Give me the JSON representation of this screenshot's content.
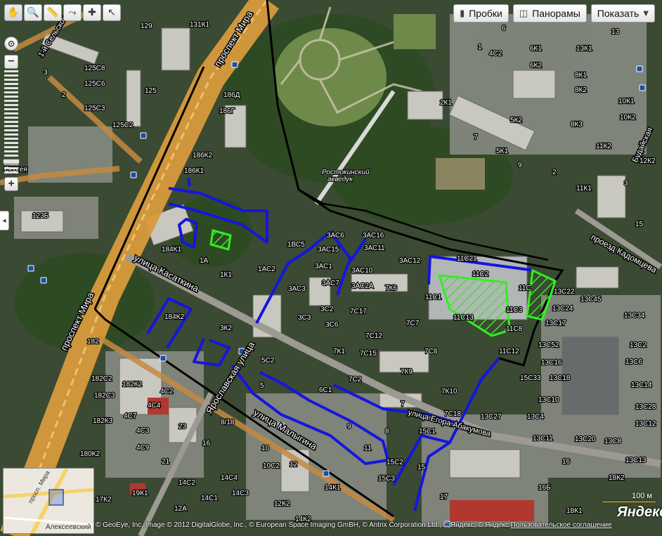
{
  "toolbar": {
    "tools": [
      {
        "name": "pan-tool",
        "glyph": "✋"
      },
      {
        "name": "magnifier-tool",
        "glyph": "🔍"
      },
      {
        "name": "ruler-tool",
        "glyph": "📏"
      },
      {
        "name": "route-tool",
        "glyph": "⤳"
      },
      {
        "name": "add-object-tool",
        "glyph": "✚"
      },
      {
        "name": "select-tool",
        "glyph": "↖"
      }
    ]
  },
  "buttons": {
    "traffic_label": "Пробки",
    "panoramas_label": "Панорамы",
    "show_label": "Показать",
    "show_arrow": "▼"
  },
  "zoom": {
    "plus": "+",
    "minus": "−",
    "reset": "⊙"
  },
  "side_tab": "◂",
  "street_labels": {
    "prospekt_mira_top": "проспект Мира",
    "prospekt_mira_bottom": "проспект Мира",
    "ul_kasatkina": "улица Касаткина",
    "yaroslavskaya": "Ярославская улица",
    "ul_malygina": "улица Малыгина",
    "ul_egora": "улица Егора Абакумова",
    "rostokinsky": "Ростокинский акведук",
    "proezd_kadomtseva": "проезд Кадомцева",
    "budaysk": "Будайская",
    "sergeya": "Сергея",
    "first_selskokh": "1-й Сельскох"
  },
  "house_numbers": [
    "129",
    "131К1",
    "125С8",
    "125С6",
    "125С3",
    "125С2",
    "125",
    "2",
    "3",
    "186Д",
    "186Г",
    "186К2",
    "186К1",
    "123Б",
    "184К1",
    "1А",
    "1К1",
    "1АС2",
    "1ВС5",
    "3АС6",
    "3АС16",
    "3АС15",
    "3АС1",
    "3АС11",
    "3АС10",
    "3АС3",
    "3АС7",
    "3АС2А",
    "7К6",
    "3АС12",
    "11С21",
    "11С2",
    "11С",
    "11С1",
    "11С3",
    "11С13",
    "11С8",
    "11С12",
    "13С22",
    "13С24",
    "13С17",
    "13С45",
    "13С34",
    "13С2",
    "13С6",
    "13С52",
    "13С16",
    "13С18",
    "15С33",
    "13С14",
    "13С28",
    "13С10",
    "13С4",
    "13С27",
    "13С12",
    "13С11",
    "13С20",
    "13С8",
    "13С13",
    "184К2",
    "3К2",
    "3С2",
    "3С3",
    "3С6",
    "7С17",
    "7С7",
    "7С12",
    "7С15",
    "7К1",
    "7С8",
    "7К9",
    "7С2",
    "7К10",
    "7С18",
    "5С2",
    "5",
    "6С1",
    "7",
    "8",
    "9",
    "11",
    "15С1",
    "15С2",
    "15С3",
    "15",
    "182",
    "182С2",
    "182К2",
    "182С3",
    "182К3",
    "4С2",
    "4С4",
    "4С7",
    "4С3",
    "4С9",
    "23",
    "16",
    "8/18",
    "10",
    "10С2",
    "12",
    "21",
    "180К2",
    "17К2",
    "19К1",
    "14С2",
    "14С4",
    "14С3",
    "14С1",
    "12К2",
    "12А",
    "14К2",
    "14К1",
    "17",
    "16Б",
    "18К1",
    "18К2",
    "16",
    "4С2",
    "2К1",
    "5К2",
    "5К1",
    "6К1",
    "6К2",
    "8К1",
    "8К2",
    "8К3",
    "10К1",
    "10К2",
    "11К2",
    "11К1",
    "12К2",
    "13К1",
    "13",
    "15",
    "6",
    "1",
    "7",
    "9",
    "2",
    "3"
  ],
  "minimap": {
    "street_label": "просп. Мира",
    "district_label": "Алексеевский"
  },
  "copyright": "© GeoEye, Inc, Image © 2012 DigitalGlobe, Inc., © European Space Imaging GmBH, © Antrix Corporation Ltd., © Яндекс, © Яндекс",
  "terms_link": "Пользовательское соглашение",
  "scale_label": "100 м",
  "logo": "Яндекс",
  "colors": {
    "boundary_blue": "#1515e0",
    "highlight_green": "#33ee22",
    "district_border": "#000000",
    "main_road": "#e0a030",
    "secondary_road": "#c89040"
  }
}
